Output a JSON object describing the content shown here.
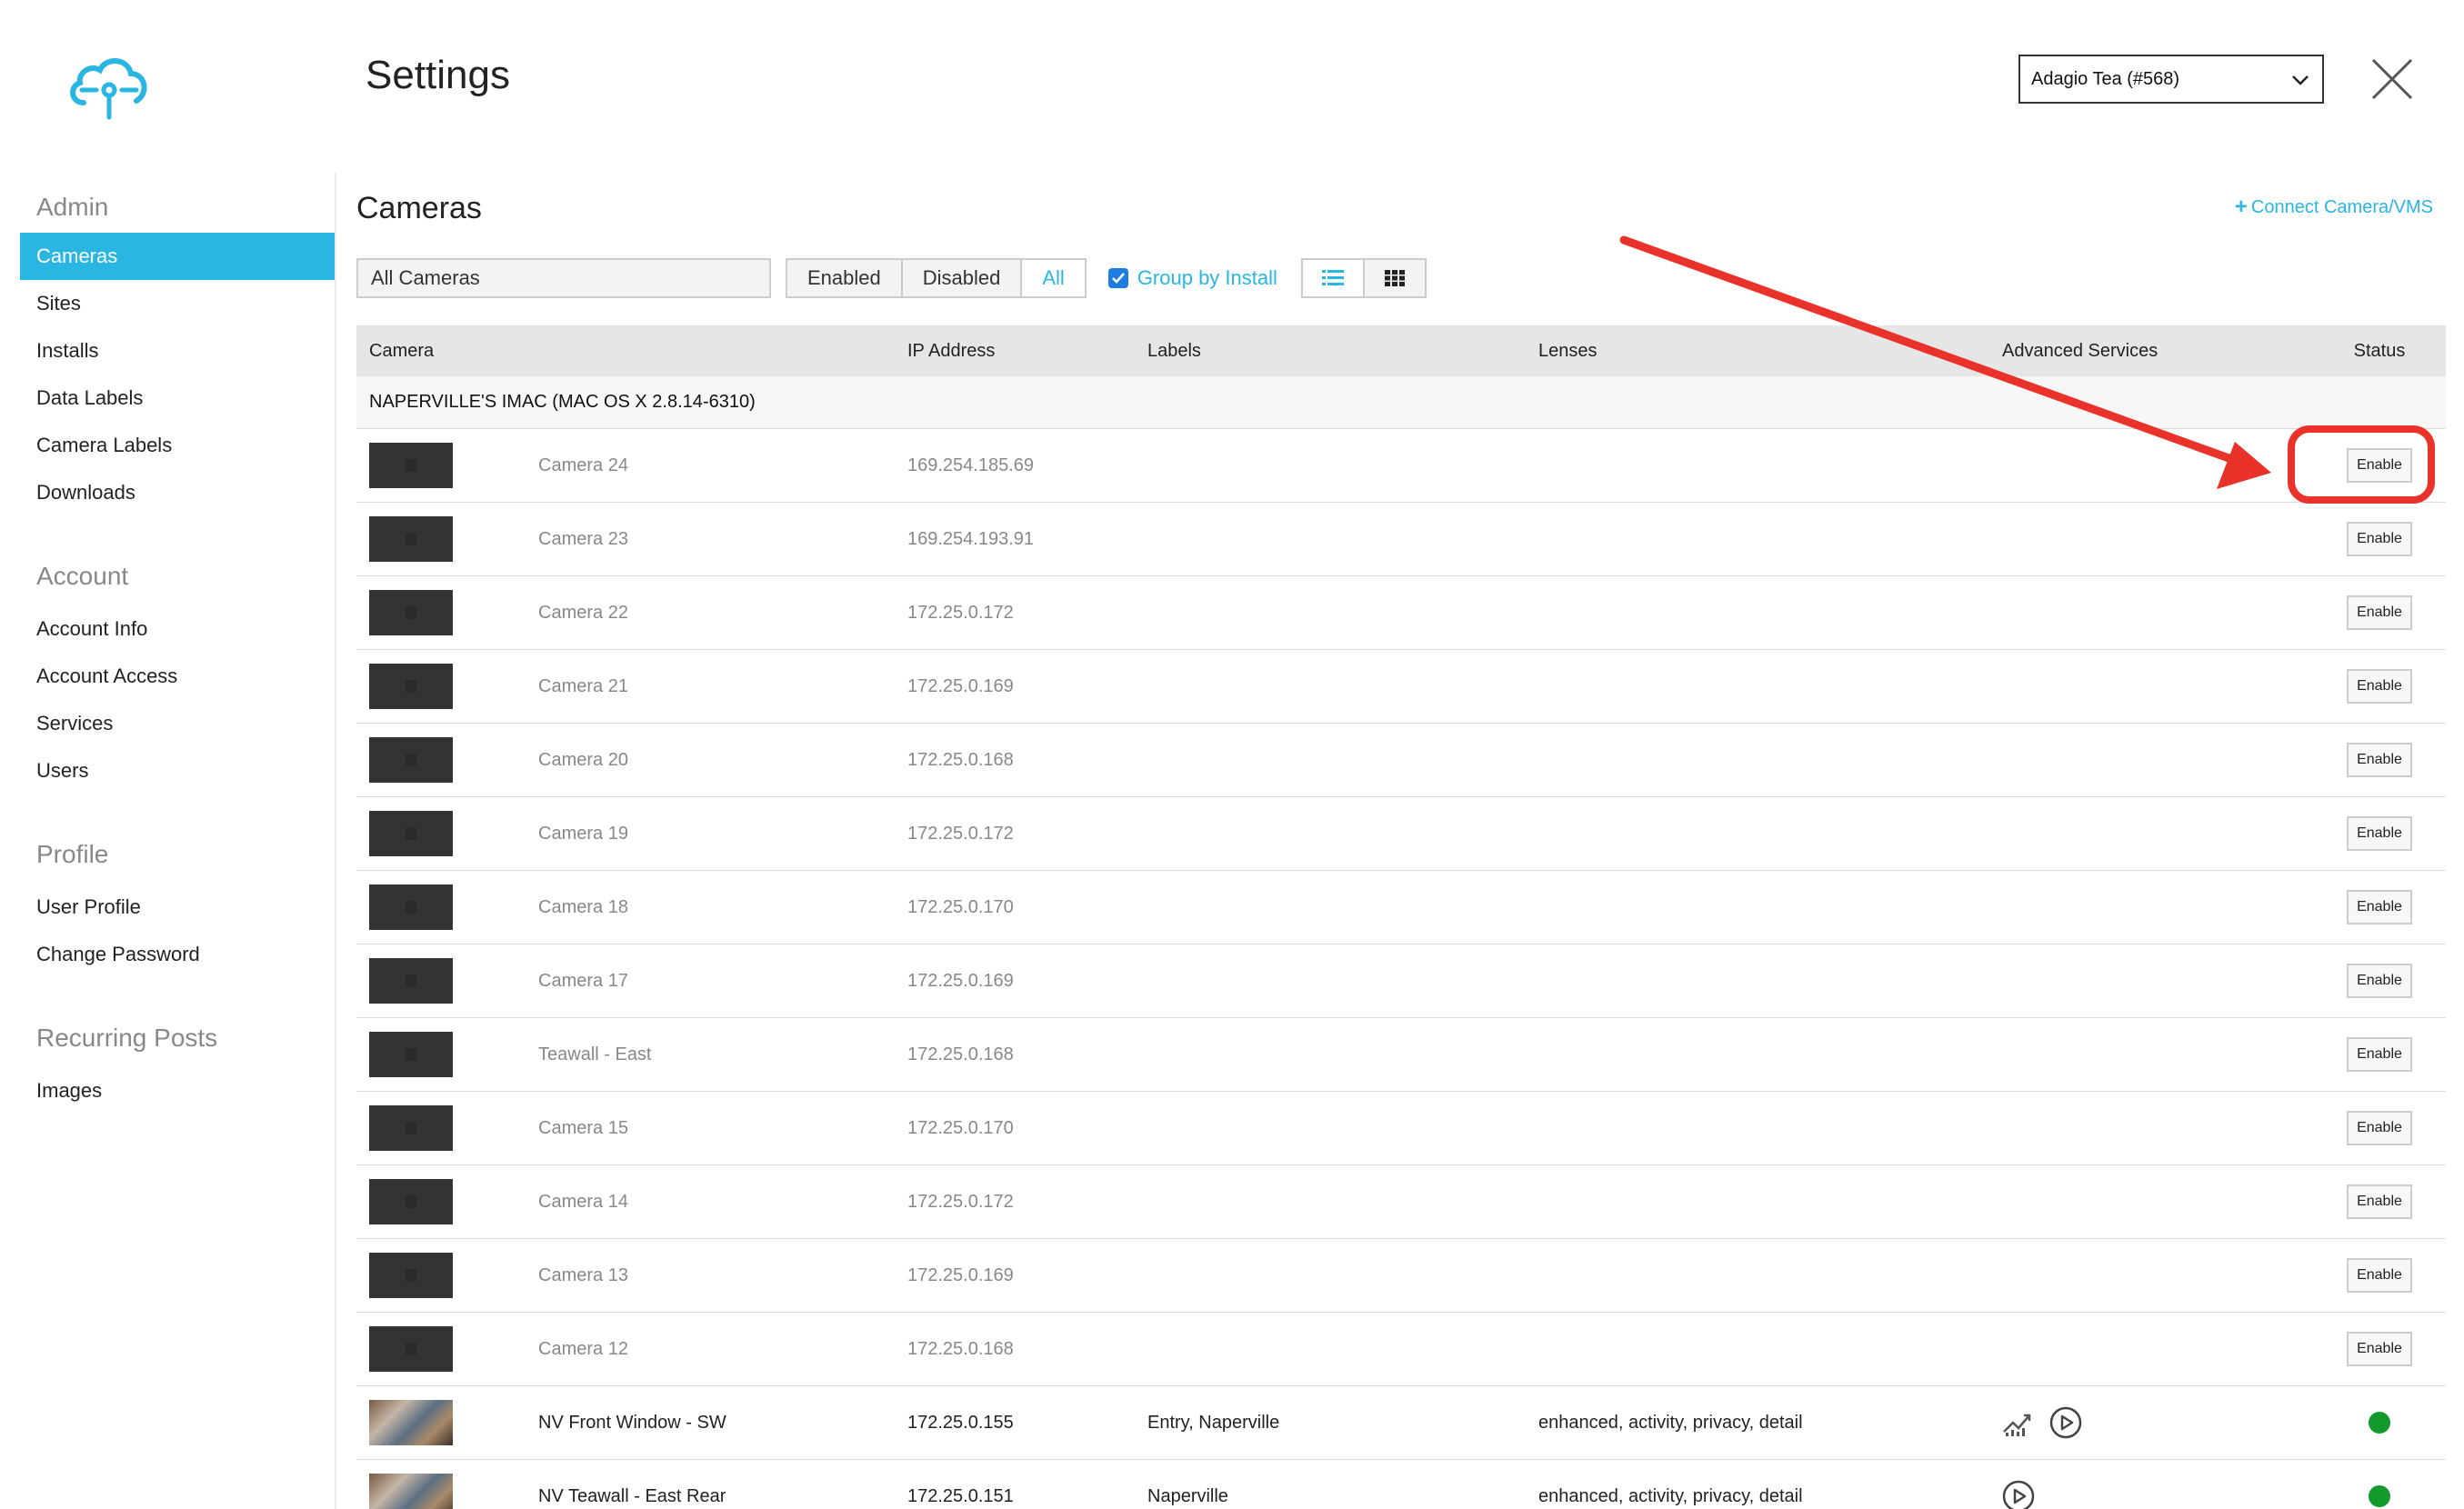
{
  "header": {
    "title": "Settings",
    "account_selector": "Adagio Tea (#568)"
  },
  "sidebar": {
    "sections": [
      {
        "title": "Admin",
        "items": [
          "Cameras",
          "Sites",
          "Installs",
          "Data Labels",
          "Camera Labels",
          "Downloads"
        ]
      },
      {
        "title": "Account",
        "items": [
          "Account Info",
          "Account Access",
          "Services",
          "Users"
        ]
      },
      {
        "title": "Profile",
        "items": [
          "User Profile",
          "Change Password"
        ]
      },
      {
        "title": "Recurring Posts",
        "items": [
          "Images"
        ]
      }
    ],
    "active_item": "Cameras"
  },
  "main": {
    "title": "Cameras",
    "connect_link": "Connect Camera/VMS",
    "filter": {
      "value": "All Cameras",
      "segments": [
        "Enabled",
        "Disabled",
        "All"
      ],
      "active_segment": "All",
      "group_by_label": "Group by Install",
      "group_by_checked": true,
      "view_modes": [
        "list-icon",
        "grid-icon"
      ],
      "active_view": "list-icon"
    },
    "table": {
      "columns": [
        "Camera",
        "IP Address",
        "Labels",
        "Lenses",
        "Advanced Services",
        "Status"
      ],
      "group": "NAPERVILLE'S IMAC (MAC OS X 2.8.14-6310)",
      "enable_label": "Enable",
      "rows": [
        {
          "name": "Camera 24",
          "ip": "169.254.185.69",
          "labels": "",
          "lenses": "",
          "status": "disabled"
        },
        {
          "name": "Camera 23",
          "ip": "169.254.193.91",
          "labels": "",
          "lenses": "",
          "status": "disabled"
        },
        {
          "name": "Camera 22",
          "ip": "172.25.0.172",
          "labels": "",
          "lenses": "",
          "status": "disabled"
        },
        {
          "name": "Camera 21",
          "ip": "172.25.0.169",
          "labels": "",
          "lenses": "",
          "status": "disabled"
        },
        {
          "name": "Camera 20",
          "ip": "172.25.0.168",
          "labels": "",
          "lenses": "",
          "status": "disabled"
        },
        {
          "name": "Camera 19",
          "ip": "172.25.0.172",
          "labels": "",
          "lenses": "",
          "status": "disabled"
        },
        {
          "name": "Camera 18",
          "ip": "172.25.0.170",
          "labels": "",
          "lenses": "",
          "status": "disabled"
        },
        {
          "name": "Camera 17",
          "ip": "172.25.0.169",
          "labels": "",
          "lenses": "",
          "status": "disabled"
        },
        {
          "name": "Teawall - East",
          "ip": "172.25.0.168",
          "labels": "",
          "lenses": "",
          "status": "disabled"
        },
        {
          "name": "Camera 15",
          "ip": "172.25.0.170",
          "labels": "",
          "lenses": "",
          "status": "disabled"
        },
        {
          "name": "Camera 14",
          "ip": "172.25.0.172",
          "labels": "",
          "lenses": "",
          "status": "disabled"
        },
        {
          "name": "Camera 13",
          "ip": "172.25.0.169",
          "labels": "",
          "lenses": "",
          "status": "disabled"
        },
        {
          "name": "Camera 12",
          "ip": "172.25.0.168",
          "labels": "",
          "lenses": "",
          "status": "disabled"
        },
        {
          "name": "NV Front Window - SW",
          "ip": "172.25.0.155",
          "labels": "Entry, Naperville",
          "lenses": "enhanced, activity, privacy, detail",
          "status": "enabled",
          "advanced": [
            "analytics-icon",
            "play-icon"
          ]
        },
        {
          "name": "NV Teawall - East Rear",
          "ip": "172.25.0.151",
          "labels": "Naperville",
          "lenses": "enhanced, activity, privacy, detail",
          "status": "enabled",
          "advanced": [
            "play-icon"
          ]
        }
      ]
    }
  },
  "colors": {
    "accent": "#29b6e3",
    "status_ok": "#129a2c",
    "annotation": "#e8322a"
  }
}
